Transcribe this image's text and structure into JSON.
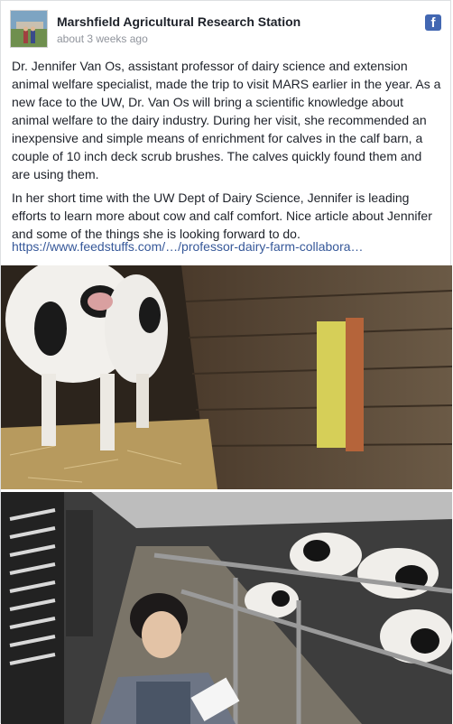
{
  "post": {
    "page_name": "Marshfield Agricultural Research Station",
    "timestamp": "about 3 weeks ago",
    "platform_icon": "facebook-icon",
    "paragraphs": [
      "Dr. Jennifer Van Os, assistant professor of dairy science and extension animal welfare specialist, made the trip to visit MARS earlier in the year. As a new face to the UW, Dr. Van Os will bring a scientific knowledge about animal welfare to the dairy industry. During her visit, she recommended an inexpensive and simple means of enrichment for calves in the calf barn, a couple of 10 inch deck scrub brushes. The calves quickly found them and are using them.",
      "In her short time with the UW Dept of Dairy Science, Jennifer is leading efforts to learn more about cow and calf comfort. Nice article about Jennifer and some of the things she is looking forward to do."
    ],
    "link_text": "https://www.feedstuffs.com/…/professor-dairy-farm-collabora…"
  },
  "colors": {
    "link": "#365899",
    "facebook_blue": "#4267b2",
    "text": "#1d2129",
    "meta": "#90949c"
  }
}
